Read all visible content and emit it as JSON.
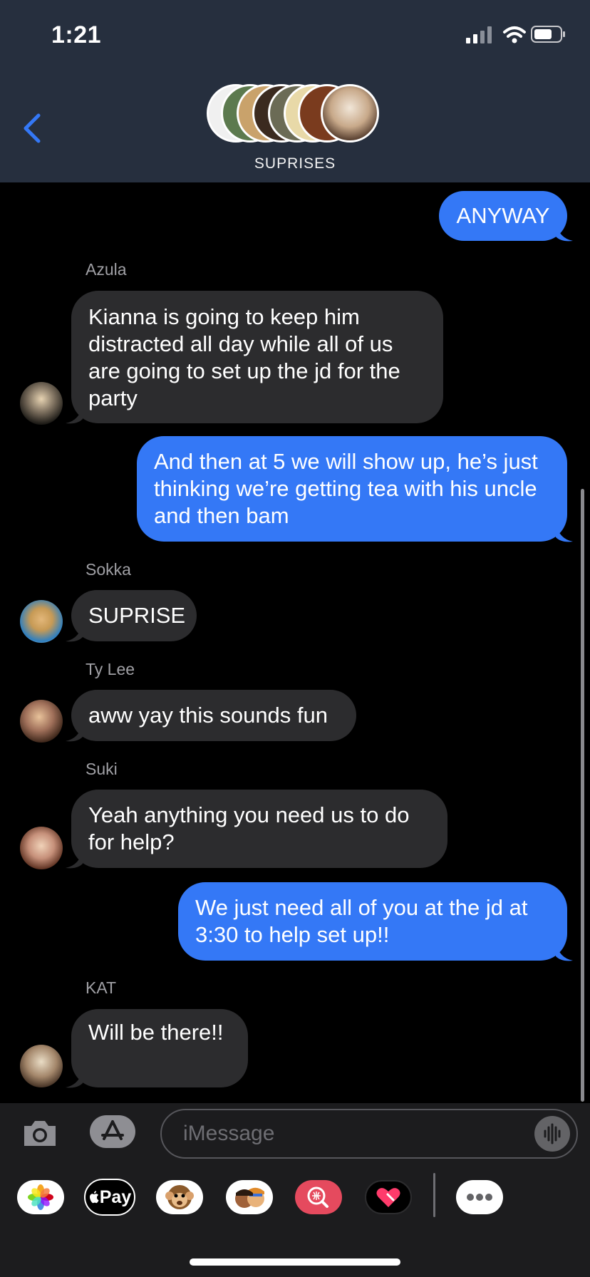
{
  "status_bar": {
    "time": "1:21"
  },
  "header": {
    "group_name": "SUPRISES"
  },
  "messages": [
    {
      "id": "m1",
      "direction": "out",
      "text": "ANYWAY"
    },
    {
      "id": "m2",
      "direction": "in",
      "sender": "Azula",
      "text": "Kianna is going to keep him distracted all day while all of us are going to set up the jd for the party"
    },
    {
      "id": "m3",
      "direction": "out",
      "text": "And then at 5 we will show up, he’s just thinking we’re getting tea with his uncle and then bam"
    },
    {
      "id": "m4",
      "direction": "in",
      "sender": "Sokka",
      "text": "SUPRISE"
    },
    {
      "id": "m5",
      "direction": "in",
      "sender": "Ty Lee",
      "text": "aww yay this sounds fun"
    },
    {
      "id": "m6",
      "direction": "in",
      "sender": "Suki",
      "text": "Yeah anything you need us to do for help?"
    },
    {
      "id": "m7",
      "direction": "out",
      "text": "We just need all of you at the jd at 3:30 to help set up!!"
    },
    {
      "id": "m8",
      "direction": "in",
      "sender": "KAT",
      "text": "Will be there!!"
    }
  ],
  "input": {
    "placeholder": "iMessage"
  },
  "app_drawer": {
    "items": [
      {
        "name": "photos-app-icon"
      },
      {
        "name": "apple-pay-app-icon",
        "label": "Pay"
      },
      {
        "name": "animoji-app-icon"
      },
      {
        "name": "memoji-app-icon"
      },
      {
        "name": "image-search-app-icon"
      },
      {
        "name": "digital-touch-app-icon"
      },
      {
        "name": "more-apps-icon"
      }
    ]
  },
  "colors": {
    "header_bg": "#262f3e",
    "outgoing_bubble": "#3478f6",
    "incoming_bubble": "#2c2c2e",
    "accent": "#3478f6"
  }
}
